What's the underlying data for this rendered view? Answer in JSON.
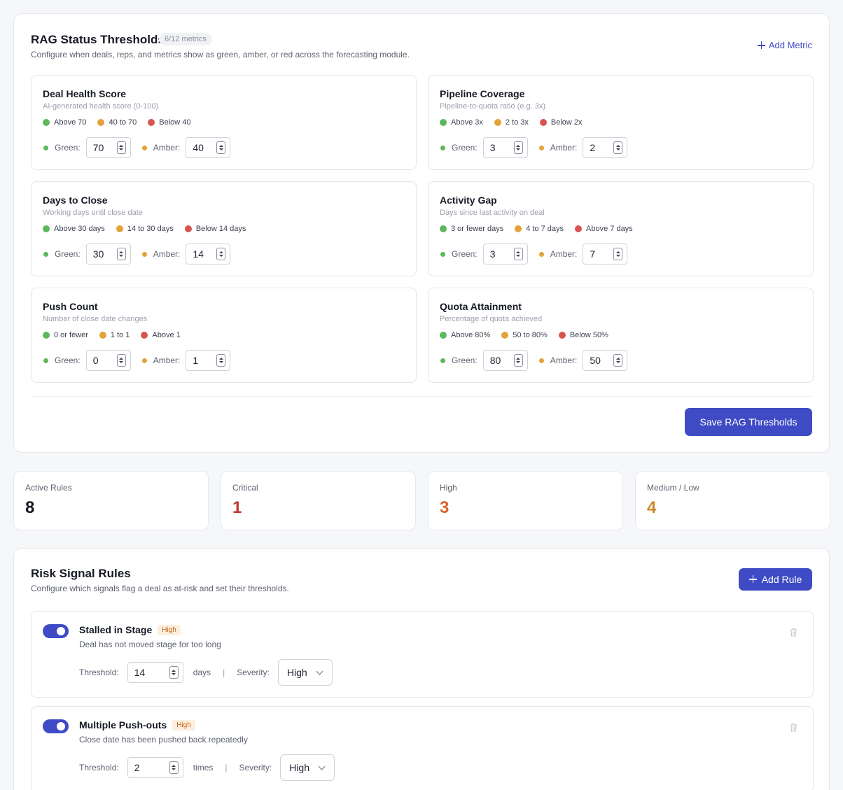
{
  "rag": {
    "title": "RAG Status Thresholds",
    "count_badge": "6/12 metrics",
    "subtitle": "Configure when deals, reps, and metrics show as green, amber, or red across the forecasting module.",
    "add_metric_label": "Add Metric",
    "save_label": "Save RAG Thresholds",
    "green_label": "Green:",
    "amber_label": "Amber:",
    "metrics": [
      {
        "name": "Deal Health Score",
        "desc": "AI-generated health score (0-100)",
        "legend_green": "Above 70",
        "legend_amber": "40 to 70",
        "legend_red": "Below 40",
        "green": "70",
        "amber": "40"
      },
      {
        "name": "Pipeline Coverage",
        "desc": "Pipeline-to-quota ratio (e.g. 3x)",
        "legend_green": "Above 3x",
        "legend_amber": "2 to 3x",
        "legend_red": "Below 2x",
        "green": "3",
        "amber": "2"
      },
      {
        "name": "Days to Close",
        "desc": "Working days until close date",
        "legend_green": "Above 30 days",
        "legend_amber": "14 to 30 days",
        "legend_red": "Below 14 days",
        "green": "30",
        "amber": "14"
      },
      {
        "name": "Activity Gap",
        "desc": "Days since last activity on deal",
        "legend_green": "3 or fewer days",
        "legend_amber": "4 to 7 days",
        "legend_red": "Above 7 days",
        "green": "3",
        "amber": "7"
      },
      {
        "name": "Push Count",
        "desc": "Number of close date changes",
        "legend_green": "0 or fewer",
        "legend_amber": "1 to 1",
        "legend_red": "Above 1",
        "green": "0",
        "amber": "1"
      },
      {
        "name": "Quota Attainment",
        "desc": "Percentage of quota achieved",
        "legend_green": "Above 80%",
        "legend_amber": "50 to 80%",
        "legend_red": "Below 50%",
        "green": "80",
        "amber": "50"
      }
    ]
  },
  "stats": [
    {
      "label": "Active Rules",
      "value": "8",
      "color": "#161a25"
    },
    {
      "label": "Critical",
      "value": "1",
      "color": "#c0392b"
    },
    {
      "label": "High",
      "value": "3",
      "color": "#d9652b"
    },
    {
      "label": "Medium / Low",
      "value": "4",
      "color": "#c98a2b"
    }
  ],
  "risk": {
    "title": "Risk Signal Rules",
    "subtitle": "Configure which signals flag a deal as at-risk and set their thresholds.",
    "add_rule_label": "Add Rule",
    "threshold_label": "Threshold:",
    "severity_label": "Severity:",
    "separator": "|",
    "rules": [
      {
        "name": "Stalled in Stage",
        "badge": "High",
        "desc": "Deal has not moved stage for too long",
        "threshold": "14",
        "unit": "days",
        "severity": "High",
        "enabled": true
      },
      {
        "name": "Multiple Push-outs",
        "badge": "High",
        "desc": "Close date has been pushed back repeatedly",
        "threshold": "2",
        "unit": "times",
        "severity": "High",
        "enabled": true
      }
    ]
  },
  "colors": {
    "accent": "#3f4bc4",
    "green": "#5cb85c",
    "amber": "#e3a33a",
    "red": "#d9534f"
  },
  "icons": {
    "add": "plus-icon",
    "delete": "trash-icon",
    "dropdown": "chevron-down-icon",
    "spinner": "spinner-icon"
  }
}
